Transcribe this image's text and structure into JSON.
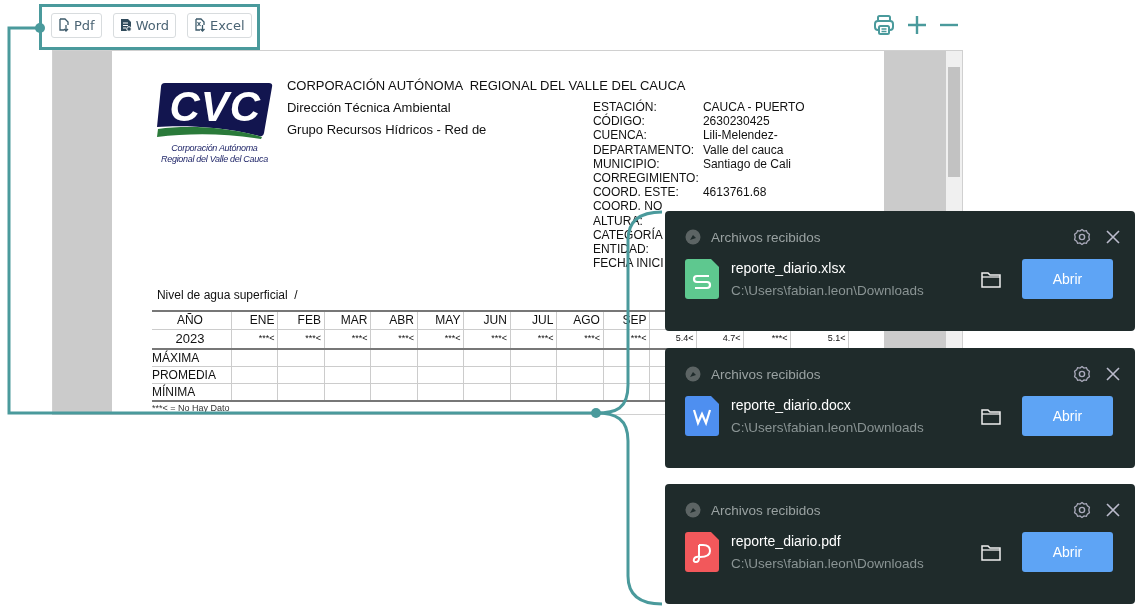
{
  "toolbar": {
    "buttons": [
      {
        "kind": "pdf",
        "label": "Pdf"
      },
      {
        "kind": "word",
        "label": "Word"
      },
      {
        "kind": "excel",
        "label": "Excel"
      }
    ]
  },
  "document": {
    "logo": {
      "mark": "CVC",
      "caption": [
        "Corporación Autónoma",
        "Regional del Valle del Cauca"
      ]
    },
    "header_lines": [
      "CORPORACIÓN AUTÓNOMA  REGIONAL DEL VALLE DEL CAUCA",
      "Dirección Técnica Ambiental",
      "Grupo Recursos Hídricos - Red de"
    ],
    "fields": [
      {
        "label": "ESTACIÓN:",
        "value": "CAUCA - PUERTO"
      },
      {
        "label": "CÓDIGO:",
        "value": "2630230425"
      },
      {
        "label": "CUENCA:",
        "value": "Lili-Melendez-"
      },
      {
        "label": "DEPARTAMENTO:",
        "value": "Valle del cauca"
      },
      {
        "label": "MUNICIPIO:",
        "value": "Santiago de Cali"
      },
      {
        "label": "CORREGIMIENTO:"
      },
      {
        "label": "COORD. ESTE:",
        "value": "4613761.68"
      },
      {
        "label": "COORD. NO"
      },
      {
        "label": "ALTURA:"
      },
      {
        "label": "CATEGORÍA"
      },
      {
        "label": "ENTIDAD:"
      },
      {
        "label": "FECHA INICI"
      }
    ],
    "section_title": "Nivel de agua superficial  /",
    "table": {
      "columns": [
        "AÑO",
        "ENE",
        "FEB",
        "MAR",
        "ABR",
        "MAY",
        "JUN",
        "JUL",
        "AGO",
        "SEP"
      ],
      "rows": [
        {
          "kind": "year",
          "cells": [
            "2023",
            "***<",
            "***<",
            "***<",
            "***<",
            "***<",
            "***<",
            "***<",
            "***<",
            "***<",
            "5.4<",
            "4.7<",
            "***<",
            "5.1<"
          ]
        },
        {
          "kind": "stat",
          "cells": [
            "MÁXIMA"
          ]
        },
        {
          "kind": "stat",
          "cells": [
            "PROMEDIA"
          ]
        },
        {
          "kind": "stat",
          "cells": [
            "MÍNIMA"
          ]
        }
      ]
    },
    "legend": "***< = No Hay Dato"
  },
  "notifications": [
    {
      "title": "Archivos recibidos",
      "kind": "xlsx",
      "file": "reporte_diario.xlsx",
      "path": "C:\\Users\\fabian.leon\\Downloads",
      "button": "Abrir"
    },
    {
      "title": "Archivos recibidos",
      "kind": "docx",
      "file": "reporte_diario.docx",
      "path": "C:\\Users\\fabian.leon\\Downloads",
      "button": "Abrir"
    },
    {
      "title": "Archivos recibidos",
      "kind": "pdf",
      "file": "reporte_diario.pdf",
      "path": "C:\\Users\\fabian.leon\\Downloads",
      "button": "Abrir"
    }
  ]
}
